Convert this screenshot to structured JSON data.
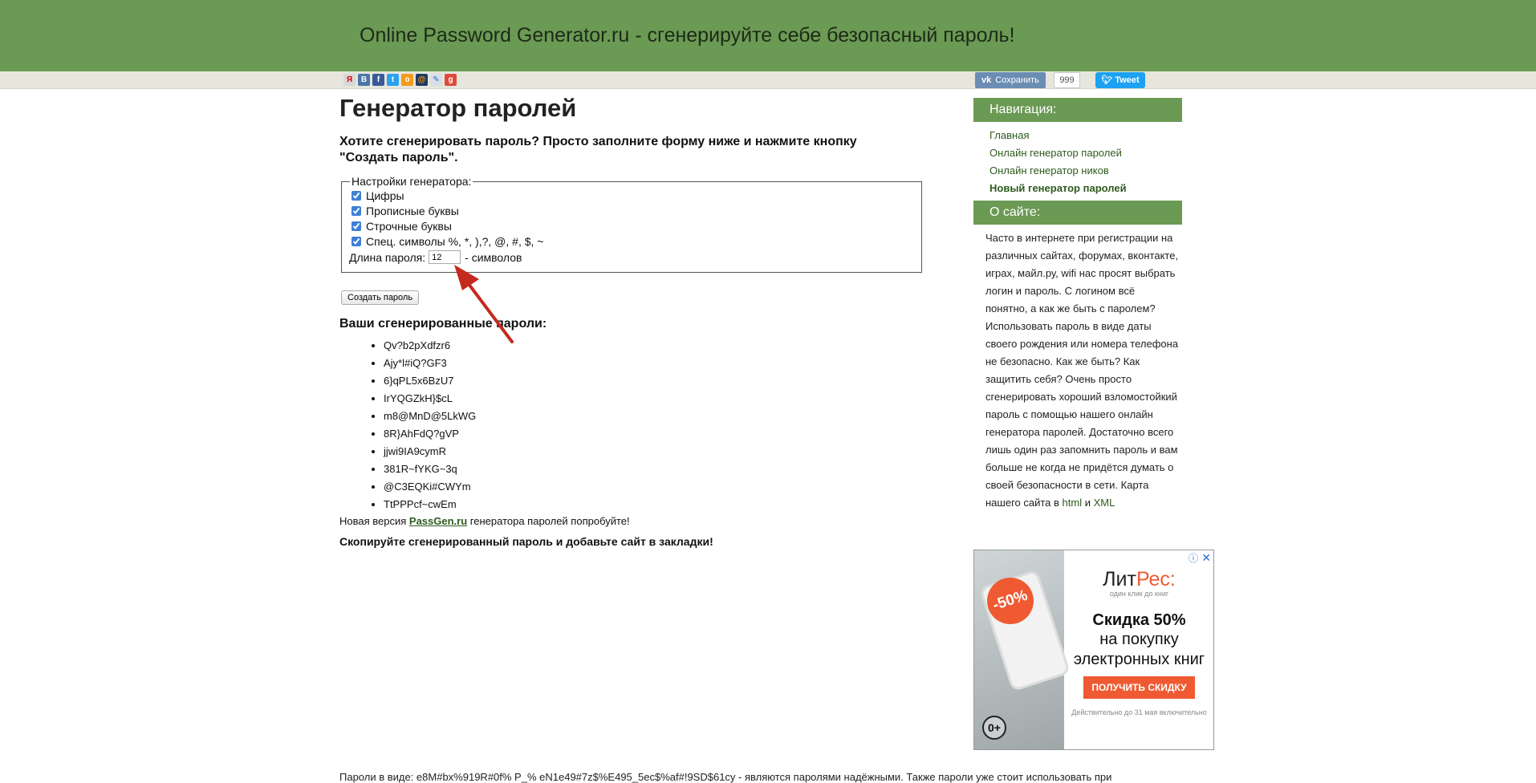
{
  "header": {
    "title": "Online Password Generator.ru - сгенерируйте себе безопасный пароль!"
  },
  "sharebar": {
    "icons": [
      "yandex-icon",
      "vk-icon",
      "facebook-icon",
      "twitter-icon",
      "odnoklassniki-icon",
      "mailru-icon",
      "livejournal-icon",
      "google-plus-icon"
    ],
    "vk_save_label": "Сохранить",
    "vk_count": "999",
    "tweet_label": "Tweet"
  },
  "main": {
    "title": "Генератор паролей",
    "lead": "Хотите сгенерировать пароль? Просто заполните форму ниже и нажмите кнопку \"Создать пароль\".",
    "settings": {
      "legend": "Настройки генератора:",
      "options": [
        {
          "label": "Цифры",
          "checked": true
        },
        {
          "label": "Прописные буквы",
          "checked": true
        },
        {
          "label": "Строчные буквы",
          "checked": true
        },
        {
          "label": "Спец. символы %, *, ),?, @, #, $, ~",
          "checked": true
        }
      ],
      "length_label": "Длина пароля:",
      "length_value": "12",
      "length_suffix": "- символов"
    },
    "generate_button": "Создать пароль",
    "results_title": "Ваши сгенерированные пароли:",
    "passwords": [
      "Qv?b2pXdfzr6",
      "Ajy*l#iQ?GF3",
      "6}qPL5x6BzU7",
      "IrYQGZkH}$cL",
      "m8@MnD@5LkWG",
      "8R}AhFdQ?gVP",
      "jjwi9IA9cymR",
      "381R~fYKG~3q",
      "@C3EQKi#CWYm",
      "TtPPPcf~cwEm"
    ],
    "new_version_prefix": "Новая версия",
    "new_version_link": "PassGen.ru",
    "new_version_suffix": "генератора паролей попробуйте!",
    "copy_note": "Скопируйте сгенерированный пароль и добавьте сайт в закладки!",
    "bottom_text": "Пароли в виде: e8M#bx%919R#0f% P_% eN1e49#7z$%E495_5ec$%af#!9SD$61cy - являются паролями надёжными. Также пароли уже стоит использовать при"
  },
  "sidebar": {
    "nav_title": "Навигация:",
    "nav_items": [
      "Главная",
      "Онлайн генератор паролей",
      "Онлайн генератор ников",
      "Новый генератор паролей"
    ],
    "about_title": "О сайте:",
    "about_text": "Часто в интернете при регистрации на различных сайтах, форумах, вконтакте, играх, майл.ру, wifi нас просят выбрать логин и пароль. С логином всё понятно, а как же быть с паролем? Использовать пароль в виде даты своего рождения или номера телефона не безопасно. Как же быть? Как защитить себя? Очень просто сгенерировать хороший взломостойкий пароль с помощью нашего онлайн генератора паролей. Достаточно всего лишь один раз запомнить пароль и вам больше не когда не придётся думать о своей безопасности в сети. Карта нашего сайта в",
    "about_link_html": "html",
    "about_and": "и",
    "about_link_xml": "XML"
  },
  "ad": {
    "badge": "-50%",
    "age": "0+",
    "logo_left": "Лит",
    "logo_right": "Рес:",
    "logo_sub": "один клик до книг",
    "title": "Скидка 50%",
    "desc": "на покупку электронных книг",
    "cta": "ПОЛУЧИТЬ СКИДКУ",
    "note": "Действительно до 31 мая включительно",
    "close": "✕",
    "info": "ⓘ"
  },
  "colors": {
    "header_bg": "#6b9a55",
    "link": "#2f5a1e",
    "accent": "#ef5a32"
  }
}
